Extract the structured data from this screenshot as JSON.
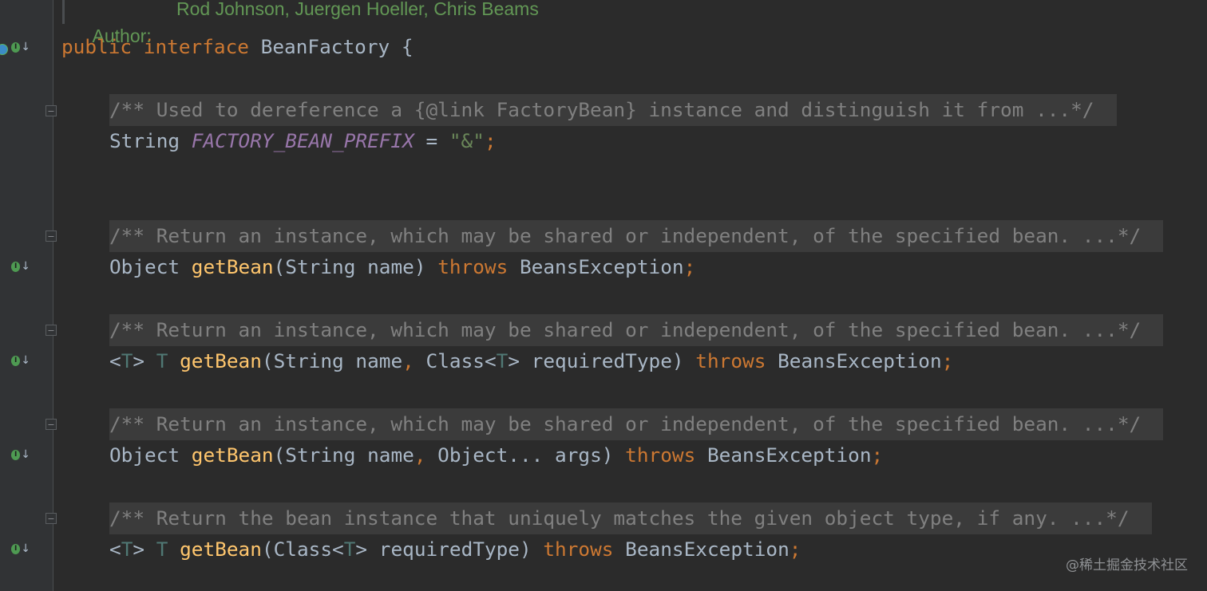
{
  "header_doc": {
    "author_label": "Author:",
    "author_value": "Rod Johnson, Juergen Hoeller, Chris Beams"
  },
  "code": {
    "interface_line": {
      "kw_public": "public",
      "kw_interface": "interface",
      "name": "BeanFactory",
      "brace": " {"
    },
    "folded_doc_1": "/** Used to dereference a {@link FactoryBean} instance and distinguish it from ...*/",
    "field_line": {
      "type": "String ",
      "name": "FACTORY_BEAN_PREFIX",
      "eq": " = ",
      "value": "\"&\"",
      "semi": ";"
    },
    "methods": [
      {
        "doc": "/** Return an instance, which may be shared or independent, of the specified bean. ...*/",
        "generic_open": "",
        "generic_t": "",
        "generic_close": "",
        "return_t": "",
        "return_type": "Object ",
        "name": "getBean",
        "params_a": "(String name",
        "comma": "",
        "params_b": "",
        "generic_in_open": "",
        "generic_in_t": "",
        "generic_in_close": "",
        "params_c": ") ",
        "throws": "throws",
        "exception": " BeansException",
        "semi": ";"
      },
      {
        "doc": "/** Return an instance, which may be shared or independent, of the specified bean. ...*/",
        "generic_open": "<",
        "generic_t": "T",
        "generic_close": "> ",
        "return_t": "T",
        "return_type": " ",
        "name": "getBean",
        "params_a": "(String name",
        "comma": ",",
        "params_b": " Class",
        "generic_in_open": "<",
        "generic_in_t": "T",
        "generic_in_close": ">",
        "params_c": " requiredType) ",
        "throws": "throws",
        "exception": " BeansException",
        "semi": ";"
      },
      {
        "doc": "/** Return an instance, which may be shared or independent, of the specified bean. ...*/",
        "generic_open": "",
        "generic_t": "",
        "generic_close": "",
        "return_t": "",
        "return_type": "Object ",
        "name": "getBean",
        "params_a": "(String name",
        "comma": ",",
        "params_b": " Object... args",
        "generic_in_open": "",
        "generic_in_t": "",
        "generic_in_close": "",
        "params_c": ") ",
        "throws": "throws",
        "exception": " BeansException",
        "semi": ";"
      },
      {
        "doc": "/** Return the bean instance that uniquely matches the given object type, if any. ...*/",
        "generic_open": "<",
        "generic_t": "T",
        "generic_close": "> ",
        "return_t": "T",
        "return_type": " ",
        "name": "getBean",
        "params_a": "(Class",
        "comma": "",
        "params_b": "",
        "generic_in_open": "<",
        "generic_in_t": "T",
        "generic_in_close": ">",
        "params_c": " requiredType) ",
        "throws": "throws",
        "exception": " BeansException",
        "semi": ";"
      }
    ]
  },
  "gutter": {
    "implementation_badge": "I",
    "arrow": "↓",
    "fold_marker": "−"
  },
  "watermark": "@稀土掘金技术社区",
  "colors": {
    "background": "#2b2b2b",
    "keyword": "#cc7832",
    "method": "#ffc66d",
    "constant": "#9876aa",
    "string": "#6a8759",
    "doc_comment": "#808080",
    "type_param": "#507874",
    "author_doc": "#629755"
  }
}
